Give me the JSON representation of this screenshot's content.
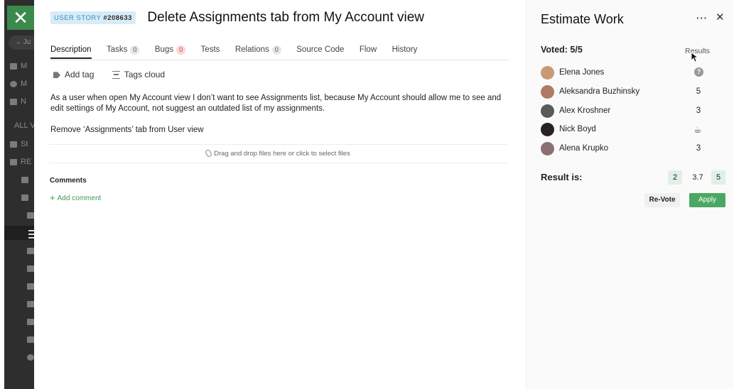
{
  "sidebar": {
    "close_glyph": "✕",
    "search_text": "Ju",
    "items": [
      "M",
      "M",
      "N",
      "ALL V",
      "St",
      "RE"
    ]
  },
  "story": {
    "type_label": "USER STORY",
    "id": "#208633",
    "title": "Delete Assignments tab from My Account view"
  },
  "tabs": [
    {
      "label": "Description"
    },
    {
      "label": "Tasks",
      "count": "0"
    },
    {
      "label": "Bugs",
      "count": "0"
    },
    {
      "label": "Tests"
    },
    {
      "label": "Relations",
      "count": "0"
    },
    {
      "label": "Source Code"
    },
    {
      "label": "Flow"
    },
    {
      "label": "History"
    }
  ],
  "tagbar": {
    "add_tag": "Add tag",
    "tags_cloud": "Tags cloud"
  },
  "description": {
    "p1": "As a user when open My Account view I don’t want to see Assignments list, because My Account should allow me to see and edit settings of My Account, not suggest an outdated list of my assignments.",
    "p2": "Remove ‘Assignments’ tab from User view"
  },
  "dropzone": {
    "text": "Drag and drop files here or click to select files"
  },
  "comments": {
    "title": "Comments",
    "add_label": "Add comment"
  },
  "estimate": {
    "title": "Estimate Work",
    "more_glyph": "···",
    "close_glyph": "✕",
    "voted_label": "Voted: 5/5",
    "results_link": "Results",
    "voters": [
      {
        "name": "Elena Jones",
        "vote": "?",
        "vote_icon": "question-icon",
        "avatar_color": "#c89a74"
      },
      {
        "name": "Aleksandra Buzhinsky",
        "vote": "5",
        "avatar_color": "#b07a64"
      },
      {
        "name": "Alex Kroshner",
        "vote": "3",
        "avatar_color": "#5a5a5a"
      },
      {
        "name": "Nick Boyd",
        "vote": "☕",
        "vote_icon": "coffee-icon",
        "avatar_color": "#2a2222"
      },
      {
        "name": "Alena Krupko",
        "vote": "3",
        "avatar_color": "#8a6f73"
      }
    ],
    "result_label": "Result is:",
    "results": [
      "2",
      "3.7",
      "5"
    ],
    "revote_label": "Re-Vote",
    "apply_label": "Apply",
    "colors": {
      "apply": "#4aa862",
      "result_box": "#e1f0e5"
    }
  }
}
